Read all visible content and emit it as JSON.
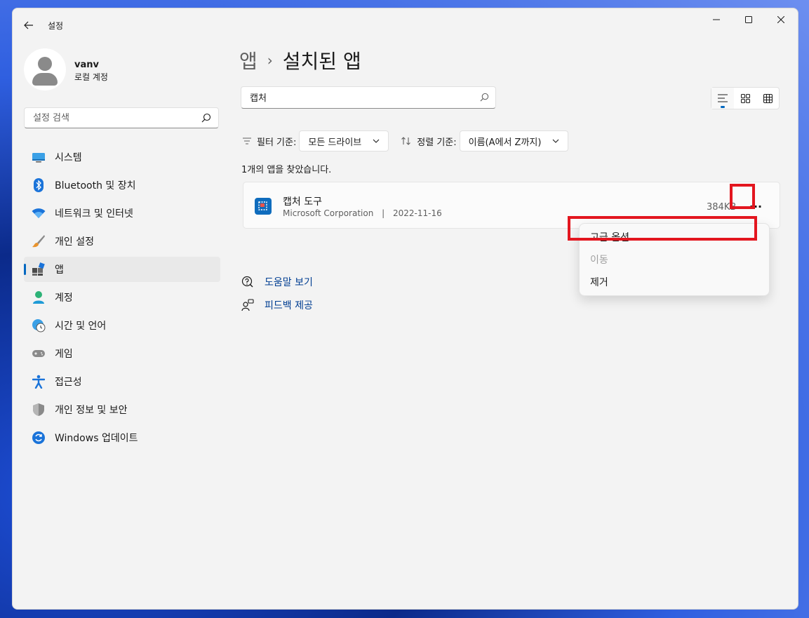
{
  "window": {
    "title": "설정",
    "controls": {
      "minimize": "minimize",
      "maximize": "maximize",
      "close": "close"
    }
  },
  "profile": {
    "name": "vanv",
    "account_type": "로컬 계정"
  },
  "sidebar": {
    "search_placeholder": "설정 검색",
    "items": [
      {
        "label": "시스템",
        "icon": "monitor-icon"
      },
      {
        "label": "Bluetooth 및 장치",
        "icon": "bluetooth-icon"
      },
      {
        "label": "네트워크 및 인터넷",
        "icon": "wifi-icon"
      },
      {
        "label": "개인 설정",
        "icon": "brush-icon"
      },
      {
        "label": "앱",
        "icon": "apps-icon",
        "active": true
      },
      {
        "label": "계정",
        "icon": "person-icon"
      },
      {
        "label": "시간 및 언어",
        "icon": "globe-clock-icon"
      },
      {
        "label": "게임",
        "icon": "gamepad-icon"
      },
      {
        "label": "접근성",
        "icon": "accessibility-icon"
      },
      {
        "label": "개인 정보 및 보안",
        "icon": "shield-icon"
      },
      {
        "label": "Windows 업데이트",
        "icon": "update-icon"
      }
    ]
  },
  "breadcrumb": {
    "parent": "앱",
    "separator": "›",
    "current": "설치된 앱"
  },
  "app_search": {
    "value": "캡처"
  },
  "filter": {
    "filter_label": "필터 기준:",
    "filter_value": "모든 드라이브",
    "sort_label": "정렬 기준:",
    "sort_value": "이름(A에서 Z까지)"
  },
  "results_text": "1개의 앱을 찾았습니다.",
  "app": {
    "name": "캡처 도구",
    "publisher": "Microsoft Corporation",
    "meta_separator": "|",
    "date": "2022-11-16",
    "size": "384KB",
    "more_label": "···"
  },
  "context_menu": {
    "items": [
      {
        "label": "고급 옵션",
        "enabled": true
      },
      {
        "label": "이동",
        "enabled": false
      },
      {
        "label": "제거",
        "enabled": true
      }
    ]
  },
  "links": {
    "help": "도움말 보기",
    "feedback": "피드백 제공"
  },
  "colors": {
    "accent": "#0067c0",
    "highlight": "#e3161f",
    "link": "#003e92"
  }
}
